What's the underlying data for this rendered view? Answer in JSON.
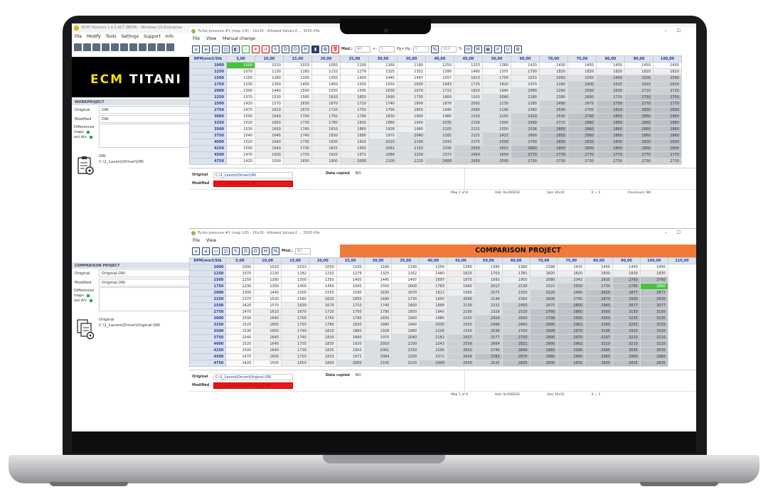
{
  "main": {
    "title": "ECM Titanium 1.0.5.ACT (BETA) - Windows 10 Enterprise",
    "menu": [
      "File",
      "Modify",
      "Tools",
      "Settings",
      "Support",
      "Info"
    ],
    "logo": {
      "brand_a": "ECM",
      "brand_b": "TITANI"
    }
  },
  "work": {
    "header": "WORKPROJECT",
    "original_label": "Original",
    "original_value": "ORI",
    "modified_label": "Modified",
    "modified_value": "ORI",
    "diff_label": "Differences",
    "diff_items": [
      "maps",
      "out.drv"
    ],
    "file_name": "ORI",
    "file_path": "C:\\1_Lavoro\\Driver\\ORI"
  },
  "comparison": {
    "header": "COMPARISON PROJECT",
    "original_label": "Original",
    "original_value": "Original.ORI",
    "modified_label": "Modified",
    "modified_value": "Original.ORI",
    "diff_label": "Differences",
    "diff_items": [
      "maps",
      "out.drv"
    ],
    "file_name": "Original",
    "file_path": "C:\\1_Lavoro\\Driver\\Original.ORI"
  },
  "map1": {
    "title": "Turbo pressure #1 (map 1/8) - 16x16 - Allowed Values:0 ... 3500 hPa",
    "menu": [
      "File",
      "View",
      "Manual change"
    ],
    "toolbar": {
      "mod_label": "Mod.:",
      "mod_value": "NO",
      "step_label": "+-",
      "step_value": "1",
      "pgpg_label": "Pg+ Pg-",
      "pgpg_value": "5",
      "pct_label": "%",
      "pct_value": "10,0"
    },
    "footer": {
      "original_label": "Original",
      "original_path": "C:\\1_Lavoro\\Driver\\ORI",
      "modified_label": "Modified",
      "modified_path": "C:\\1_Lavoro\\Driver\\ORI",
      "data_copied_label": "Data copied",
      "data_copied_value": "NO"
    },
    "status": [
      "Map 1 of 8",
      "Add. 0x3ADE92",
      "Size 16x16",
      "K = 1",
      "Checksum: NO"
    ]
  },
  "map2": {
    "title": "Turbo pressure #1 (map 1/8) - 16x16 - Allowed Values:0 ... 3500 hPa",
    "menu": [
      "File",
      "View"
    ],
    "toolbar": {
      "mod_label": "Mod.:",
      "mod_value": "NO"
    },
    "banner": "COMPARISON PROJECT",
    "footer": {
      "original_label": "Original",
      "original_path": "C:\\1_Lavoro\\Driver\\Original.ORI",
      "modified_label": "Modified",
      "modified_path": "C:\\1_Lavoro\\Driver\\Original.ORI",
      "data_copied_label": "Data copied",
      "data_copied_value": "NO"
    },
    "status": [
      "Map 1 of 8",
      "Add. 0x3ADE92",
      "Size 16x16",
      "K = 1"
    ]
  },
  "table1": {
    "corner": "RPM|mm3/Stk",
    "cols": [
      "5,00",
      "10,00",
      "15,00",
      "20,00",
      "25,00",
      "30,00",
      "35,00",
      "40,00",
      "45,00",
      "50,00",
      "60,00",
      "70,00",
      "75,00",
      "80,00",
      "90,00",
      "100,00"
    ],
    "rows": [
      {
        "rpm": "1000",
        "v": [
          "1000",
          "1010",
          "1033",
          "1050",
          "1100",
          "1160",
          "1190",
          "1250",
          "1323",
          "1360",
          "1420",
          "1430",
          "1450",
          "1450",
          "1450",
          "1450"
        ]
      },
      {
        "rpm": "1250",
        "v": [
          "1070",
          "1130",
          "1182",
          "1232",
          "1279",
          "1325",
          "1352",
          "1390",
          "1460",
          "1555",
          "1700",
          "1820",
          "1820",
          "1820",
          "1820",
          "1820"
        ]
      },
      {
        "rpm": "1500",
        "v": [
          "1150",
          "1260",
          "1300",
          "1350",
          "1400",
          "1445",
          "1497",
          "1557",
          "1613",
          "1700",
          "1833",
          "2050",
          "2250",
          "2400",
          "2500",
          "2500"
        ]
      },
      {
        "rpm": "1750",
        "v": [
          "1230",
          "1350",
          "1400",
          "1450",
          "1500",
          "1550",
          "1600",
          "1643",
          "1725",
          "1820",
          "1970",
          "2180",
          "2400",
          "2525",
          "2610",
          "2610"
        ]
      },
      {
        "rpm": "2000",
        "v": [
          "1300",
          "1440",
          "1500",
          "1550",
          "1590",
          "1630",
          "1670",
          "1722",
          "1820",
          "1940",
          "2080",
          "2290",
          "2500",
          "2630",
          "2710",
          "2710"
        ]
      },
      {
        "rpm": "2250",
        "v": [
          "1370",
          "1520",
          "1580",
          "1620",
          "1650",
          "1690",
          "1730",
          "1800",
          "1920",
          "2040",
          "2180",
          "2390",
          "2600",
          "2720",
          "2750",
          "2750"
        ]
      },
      {
        "rpm": "2500",
        "v": [
          "1420",
          "1570",
          "1630",
          "1670",
          "1710",
          "1740",
          "1800",
          "1878",
          "2002",
          "2130",
          "2280",
          "2490",
          "2675",
          "2750",
          "2770",
          "2770"
        ]
      },
      {
        "rpm": "2750",
        "v": [
          "1470",
          "1610",
          "1670",
          "1720",
          "1750",
          "1790",
          "1850",
          "1940",
          "2060",
          "2190",
          "2360",
          "2590",
          "2705",
          "2810",
          "2830",
          "2830"
        ]
      },
      {
        "rpm": "3000",
        "v": [
          "1500",
          "1640",
          "1700",
          "1750",
          "1790",
          "1830",
          "1900",
          "1980",
          "2103",
          "2250",
          "2429",
          "2635",
          "2790",
          "2850",
          "2860",
          "2860"
        ]
      },
      {
        "rpm": "3250",
        "v": [
          "1520",
          "1650",
          "1730",
          "1780",
          "1820",
          "1880",
          "1940",
          "2035",
          "2156",
          "2300",
          "2499",
          "2715",
          "2860",
          "2860",
          "2860",
          "2860"
        ]
      },
      {
        "rpm": "3500",
        "v": [
          "1530",
          "1650",
          "1740",
          "1810",
          "1860",
          "1928",
          "1980",
          "2105",
          "2231",
          "2350",
          "2536",
          "2800",
          "2860",
          "2860",
          "2860",
          "2860"
        ]
      },
      {
        "rpm": "3750",
        "v": [
          "1540",
          "1645",
          "1740",
          "1830",
          "1890",
          "1970",
          "2040",
          "2182",
          "2325",
          "2427",
          "2600",
          "2855",
          "2860",
          "2860",
          "2860",
          "2860"
        ]
      },
      {
        "rpm": "4000",
        "v": [
          "1520",
          "1640",
          "1735",
          "1830",
          "1920",
          "2010",
          "2100",
          "2243",
          "2375",
          "2558",
          "2700",
          "2830",
          "2830",
          "2830",
          "2830",
          "2830"
        ]
      },
      {
        "rpm": "4250",
        "v": [
          "1500",
          "1640",
          "1730",
          "1825",
          "1950",
          "2061",
          "2150",
          "2295",
          "2435",
          "2652",
          "2800",
          "2800",
          "2800",
          "2800",
          "2800",
          "2800"
        ]
      },
      {
        "rpm": "4500",
        "v": [
          "1470",
          "1600",
          "1720",
          "1820",
          "1972",
          "2084",
          "2200",
          "2372",
          "2454",
          "2654",
          "2770",
          "2770",
          "2770",
          "2770",
          "2770",
          "2770"
        ]
      },
      {
        "rpm": "4750",
        "v": [
          "1420",
          "1500",
          "1650",
          "1800",
          "2000",
          "2100",
          "2220",
          "2400",
          "2450",
          "2500",
          "2730",
          "2730",
          "2730",
          "2730",
          "2730",
          "2730"
        ]
      }
    ]
  },
  "table2": {
    "corner": "RPM|mm3/Stk",
    "cols": [
      "5,00",
      "10,00",
      "15,00",
      "20,00",
      "25,00",
      "30,00",
      "35,00",
      "40,00",
      "45,00",
      "50,00",
      "60,00",
      "70,00",
      "75,00",
      "80,00",
      "90,00",
      "100,00",
      "110,00"
    ],
    "rows": [
      {
        "rpm": "1000",
        "v": [
          "1000",
          "1010",
          "1033",
          "1050",
          "1100",
          "1160",
          "1190",
          "1250",
          "1360",
          "1380",
          "1380",
          "1398",
          "1415",
          "1450",
          "1450",
          "1450"
        ]
      },
      {
        "rpm": "1250",
        "v": [
          "1070",
          "1130",
          "1182",
          "1232",
          "1279",
          "1325",
          "1352",
          "1480",
          "1625",
          "1703",
          "1781",
          "1820",
          "1820",
          "1830",
          "1830",
          "1830"
        ]
      },
      {
        "rpm": "1500",
        "v": [
          "1150",
          "1260",
          "1300",
          "1350",
          "1400",
          "1445",
          "1497",
          "1697",
          "1870",
          "1893",
          "1950",
          "2080",
          "2342",
          "2635",
          "2760",
          "2760"
        ]
      },
      {
        "rpm": "1750",
        "v": [
          "1230",
          "1350",
          "1400",
          "1450",
          "1500",
          "1550",
          "1600",
          "1783",
          "1960",
          "2017",
          "2130",
          "2322",
          "2550",
          "2730",
          "2795",
          "2860"
        ]
      },
      {
        "rpm": "2000",
        "v": [
          "1300",
          "1440",
          "1500",
          "1550",
          "1590",
          "1630",
          "1670",
          "1812",
          "1990",
          "2075",
          "2250",
          "2520",
          "2680",
          "2825",
          "2877",
          "2877"
        ]
      },
      {
        "rpm": "2250",
        "v": [
          "1370",
          "1520",
          "1580",
          "1620",
          "1650",
          "1690",
          "1730",
          "1850",
          "2040",
          "2146",
          "2360",
          "2600",
          "2740",
          "2870",
          "2930",
          "2930"
        ]
      },
      {
        "rpm": "2500",
        "v": [
          "1420",
          "1570",
          "1630",
          "1670",
          "1710",
          "1740",
          "1800",
          "1888",
          "2130",
          "2232",
          "2450",
          "2675",
          "2800",
          "2940",
          "3077",
          "3077"
        ]
      },
      {
        "rpm": "2750",
        "v": [
          "1470",
          "1610",
          "1670",
          "1720",
          "1750",
          "1790",
          "1850",
          "1940",
          "2190",
          "2328",
          "2520",
          "2760",
          "2860",
          "3000",
          "3150",
          "3150"
        ]
      },
      {
        "rpm": "3000",
        "v": [
          "1500",
          "1640",
          "1700",
          "1750",
          "1790",
          "1830",
          "1900",
          "1980",
          "2250",
          "2429",
          "2600",
          "2799",
          "2950",
          "3050",
          "3235",
          "3235"
        ]
      },
      {
        "rpm": "3250",
        "v": [
          "1520",
          "1650",
          "1730",
          "1780",
          "1820",
          "1880",
          "1940",
          "2035",
          "2300",
          "2499",
          "2660",
          "2890",
          "2962",
          "3160",
          "3255",
          "3255"
        ]
      },
      {
        "rpm": "3500",
        "v": [
          "1530",
          "1650",
          "1740",
          "1810",
          "1860",
          "1928",
          "1980",
          "2105",
          "2350",
          "2536",
          "2700",
          "2909",
          "2970",
          "3195",
          "3320",
          "3320"
        ]
      },
      {
        "rpm": "3750",
        "v": [
          "1540",
          "1645",
          "1740",
          "1830",
          "1890",
          "1970",
          "2040",
          "2182",
          "2427",
          "2577",
          "2750",
          "2890",
          "2970",
          "3197",
          "3210",
          "3210"
        ]
      },
      {
        "rpm": "4000",
        "v": [
          "1520",
          "1640",
          "1735",
          "1830",
          "1920",
          "2010",
          "2100",
          "2243",
          "2558",
          "2664",
          "2821",
          "2900",
          "2962",
          "3210",
          "3210",
          "3210"
        ]
      },
      {
        "rpm": "4250",
        "v": [
          "1500",
          "1640",
          "1730",
          "1825",
          "1950",
          "2061",
          "2150",
          "2295",
          "2652",
          "2740",
          "2840",
          "2960",
          "2990",
          "2995",
          "3035",
          "3035"
        ]
      },
      {
        "rpm": "4500",
        "v": [
          "1470",
          "1600",
          "1720",
          "1820",
          "1972",
          "2084",
          "2200",
          "2372",
          "2654",
          "2783",
          "2870",
          "2960",
          "2960",
          "2960",
          "2960",
          "2960"
        ]
      },
      {
        "rpm": "4750",
        "v": [
          "1420",
          "1500",
          "1650",
          "1800",
          "2000",
          "2100",
          "2220",
          "2400",
          "2500",
          "2635",
          "2835",
          "2835",
          "2835",
          "2835",
          "2835",
          "2835"
        ]
      }
    ]
  },
  "colors": {
    "highlight": "#46c33c",
    "banner": "#f07a3a",
    "header_text": "#1c3d9c",
    "modified_bg": "#e8191d"
  },
  "icons": [
    "home-icon",
    "open-icon",
    "2d-icon",
    "3d-icon",
    "save-icon",
    "check-icon",
    "cancel-icon",
    "undo-icon",
    "edit-icon",
    "copy-icon",
    "delete-icon",
    "trash-icon"
  ]
}
